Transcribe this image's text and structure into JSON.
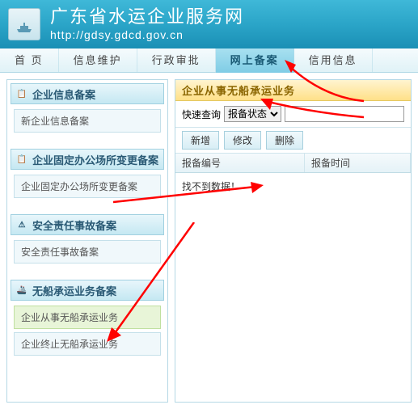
{
  "header": {
    "title": "广东省水运企业服务网",
    "url": "http://gdsy.gdcd.gov.cn"
  },
  "nav": {
    "items": [
      {
        "label": "首 页",
        "active": false
      },
      {
        "label": "信息维护",
        "active": false
      },
      {
        "label": "行政审批",
        "active": false
      },
      {
        "label": "网上备案",
        "active": true
      },
      {
        "label": "信用信息",
        "active": false
      }
    ]
  },
  "sidebar": {
    "panels": [
      {
        "title": "企业信息备案",
        "icon": "📋",
        "items": [
          {
            "label": "新企业信息备案",
            "active": false
          }
        ]
      },
      {
        "title": "企业固定办公场所变更备案",
        "icon": "📋",
        "items": [
          {
            "label": "企业固定办公场所变更备案",
            "active": false
          }
        ]
      },
      {
        "title": "安全责任事故备案",
        "icon": "⚠",
        "items": [
          {
            "label": "安全责任事故备案",
            "active": false
          }
        ]
      },
      {
        "title": "无船承运业务备案",
        "icon": "🚢",
        "items": [
          {
            "label": "企业从事无船承运业务",
            "active": true
          },
          {
            "label": "企业终止无船承运业务",
            "active": false
          }
        ]
      }
    ]
  },
  "main": {
    "title": "企业从事无船承运业务",
    "quick_search_label": "快速查询",
    "search_field_selected": "报备状态",
    "actions": {
      "add": "新增",
      "edit": "修改",
      "delete": "删除"
    },
    "columns": {
      "c1": "报备编号",
      "c2": "报备时间"
    },
    "empty_text": "找不到数据！"
  }
}
